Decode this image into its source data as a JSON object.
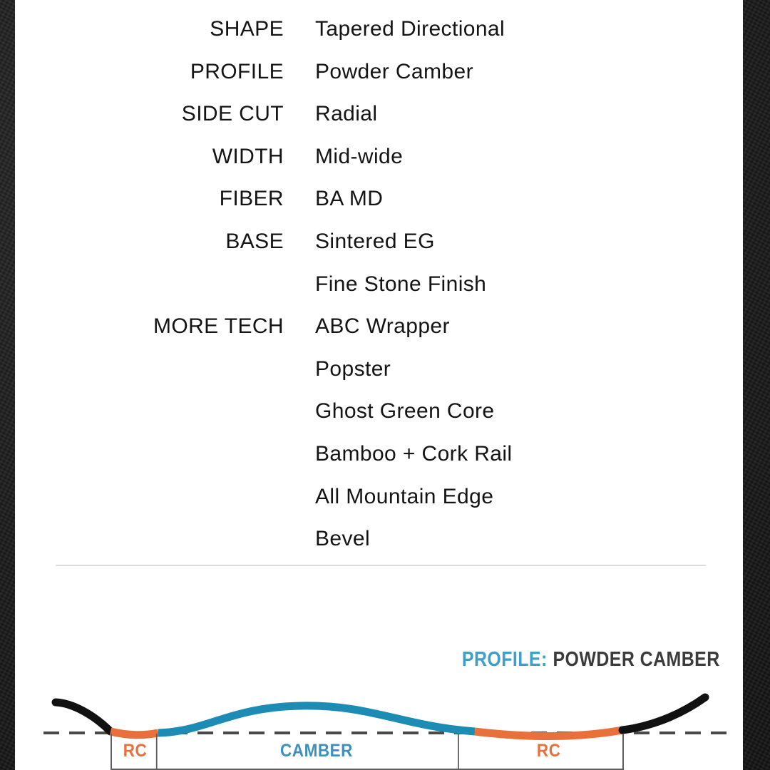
{
  "specs": [
    {
      "label": "SHAPE",
      "value": "Tapered Directional"
    },
    {
      "label": "PROFILE",
      "value": "Powder Camber"
    },
    {
      "label": "SIDE CUT",
      "value": "Radial"
    },
    {
      "label": "WIDTH",
      "value": "Mid-wide"
    },
    {
      "label": "FIBER",
      "value": "BA MD"
    },
    {
      "label": "BASE",
      "value": "Sintered EG"
    },
    {
      "label": "",
      "value": "Fine Stone Finish"
    },
    {
      "label": "MORE TECH",
      "value": "ABC Wrapper"
    },
    {
      "label": "",
      "value": "Popster"
    },
    {
      "label": "",
      "value": "Ghost Green Core"
    },
    {
      "label": "",
      "value": "Bamboo + Cork Rail"
    },
    {
      "label": "",
      "value": "All Mountain Edge"
    },
    {
      "label": "",
      "value": "Bevel"
    }
  ],
  "profile": {
    "heading_key": "PROFILE:",
    "heading_value": "POWDER CAMBER",
    "segments": [
      {
        "name": "RC",
        "kind": "rc"
      },
      {
        "name": "CAMBER",
        "kind": "camber"
      },
      {
        "name": "RC",
        "kind": "rc"
      }
    ],
    "colors": {
      "tip": "#111111",
      "rocker": "#e8703a",
      "camber": "#1c8cb5",
      "baseline": "#4a4a4a",
      "box_border": "#5e5e5e",
      "heading_key": "#3f9fc9",
      "heading_value": "#3b3b3b"
    }
  },
  "page": {
    "card_background": "#ffffff",
    "frame_color": "#1c1c1c"
  }
}
